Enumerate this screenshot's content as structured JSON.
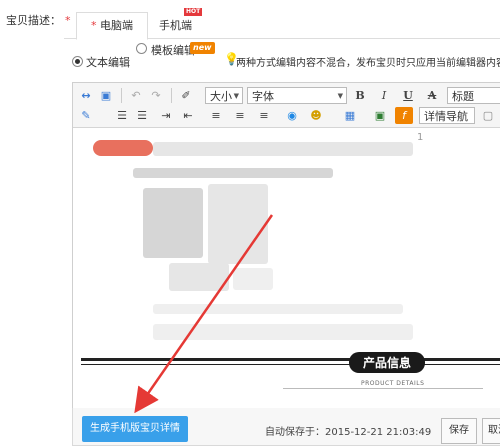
{
  "form": {
    "label": "宝贝描述：",
    "required_mark": "*"
  },
  "tabs": {
    "pc": {
      "label": "电脑端",
      "required_mark": "*"
    },
    "mobile": {
      "label": "手机端",
      "badge": "HOT"
    }
  },
  "mode": {
    "text_label": "文本编辑",
    "template_label": "模板编辑",
    "new_badge": "new",
    "tip_icon": "lightbulb-icon",
    "tip": "两种方式编辑内容不混合，发布宝贝时只应用当前编辑器内容"
  },
  "toolbar": {
    "size_select": "大小",
    "font_select": "字体",
    "heading_select": "标题",
    "detail_nav_select": "详情导航",
    "bold": "B",
    "italic": "I",
    "underline": "U",
    "strike": "A"
  },
  "editor": {
    "line_number": "1",
    "product_info_badge": "产品信息",
    "product_details_caption": "PRODUCT DETAILS"
  },
  "bottom": {
    "generate_mobile_button": "生成手机版宝贝详情",
    "autosave_label": "自动保存于：",
    "autosave_time": "2015-12-21 21:03:49",
    "save_button": "保存",
    "cancel_button": "取消"
  },
  "colors": {
    "accent_blue": "#39a0ea",
    "required_red": "#e4393c",
    "annotation_arrow": "#e53935",
    "new_badge": "#f08300"
  }
}
